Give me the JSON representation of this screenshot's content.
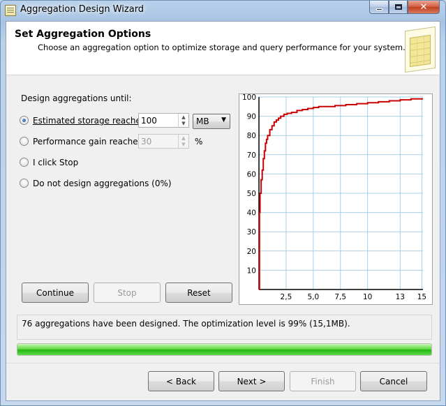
{
  "window": {
    "title": "Aggregation Design Wizard",
    "controls": {
      "minimize": "",
      "maximize": "",
      "close": "✕"
    }
  },
  "header": {
    "title": "Set Aggregation Options",
    "subtitle": "Choose an aggregation option to optimize storage and query performance for your system.",
    "icon": "spreadsheet-icon"
  },
  "options": {
    "group_label": "Design aggregations until:",
    "items": [
      {
        "label": "Estimated storage reaches",
        "checked": true
      },
      {
        "label": "Performance gain reaches",
        "checked": false
      },
      {
        "label": "I click Stop",
        "checked": false
      },
      {
        "label": "Do not design aggregations (0%)",
        "checked": false
      }
    ],
    "storage_value": "100",
    "storage_unit": "MB",
    "performance_value": "30",
    "performance_unit": "%"
  },
  "actions": {
    "continue": "Continue",
    "stop": "Stop",
    "reset": "Reset"
  },
  "chart_data": {
    "type": "line",
    "title": "",
    "xlabel": "",
    "ylabel": "",
    "x_ticks": [
      "2,5",
      "5,0",
      "7,5",
      "10",
      "13",
      "15"
    ],
    "x_tick_values": [
      2.5,
      5.0,
      7.5,
      10,
      13,
      15
    ],
    "y_ticks": [
      10,
      20,
      30,
      40,
      50,
      60,
      70,
      80,
      90,
      100
    ],
    "xlim": [
      0,
      15.1
    ],
    "ylim": [
      0,
      100
    ],
    "grid": true,
    "line_color": "#cc0000",
    "series": [
      {
        "x": [
          0,
          0.05,
          0.1,
          0.2,
          0.3,
          0.4,
          0.5,
          0.6,
          0.7,
          0.8,
          1.0,
          1.2,
          1.4,
          1.6,
          1.8,
          2.0,
          2.3,
          2.6,
          3.0,
          3.5,
          4.0,
          4.5,
          5.0,
          5.5,
          6.0,
          7.0,
          8.0,
          9.0,
          10.0,
          11.0,
          12.0,
          13.0,
          14.0,
          15.1
        ],
        "y": [
          0,
          40,
          50,
          57,
          62,
          68,
          72,
          76,
          78,
          80,
          83,
          85,
          87,
          88,
          89,
          90,
          91,
          91.5,
          92,
          93,
          93.5,
          94,
          94.5,
          95,
          95,
          95.5,
          96,
          96.5,
          97,
          97.5,
          98,
          98.5,
          99,
          99
        ]
      }
    ]
  },
  "status": {
    "message": "76 aggregations have been designed. The optimization level is 99% (15,1MB).",
    "progress": 1.0,
    "progress_color": "#23b80f"
  },
  "nav": {
    "back": "< Back",
    "next": "Next >",
    "finish": "Finish",
    "cancel": "Cancel"
  }
}
